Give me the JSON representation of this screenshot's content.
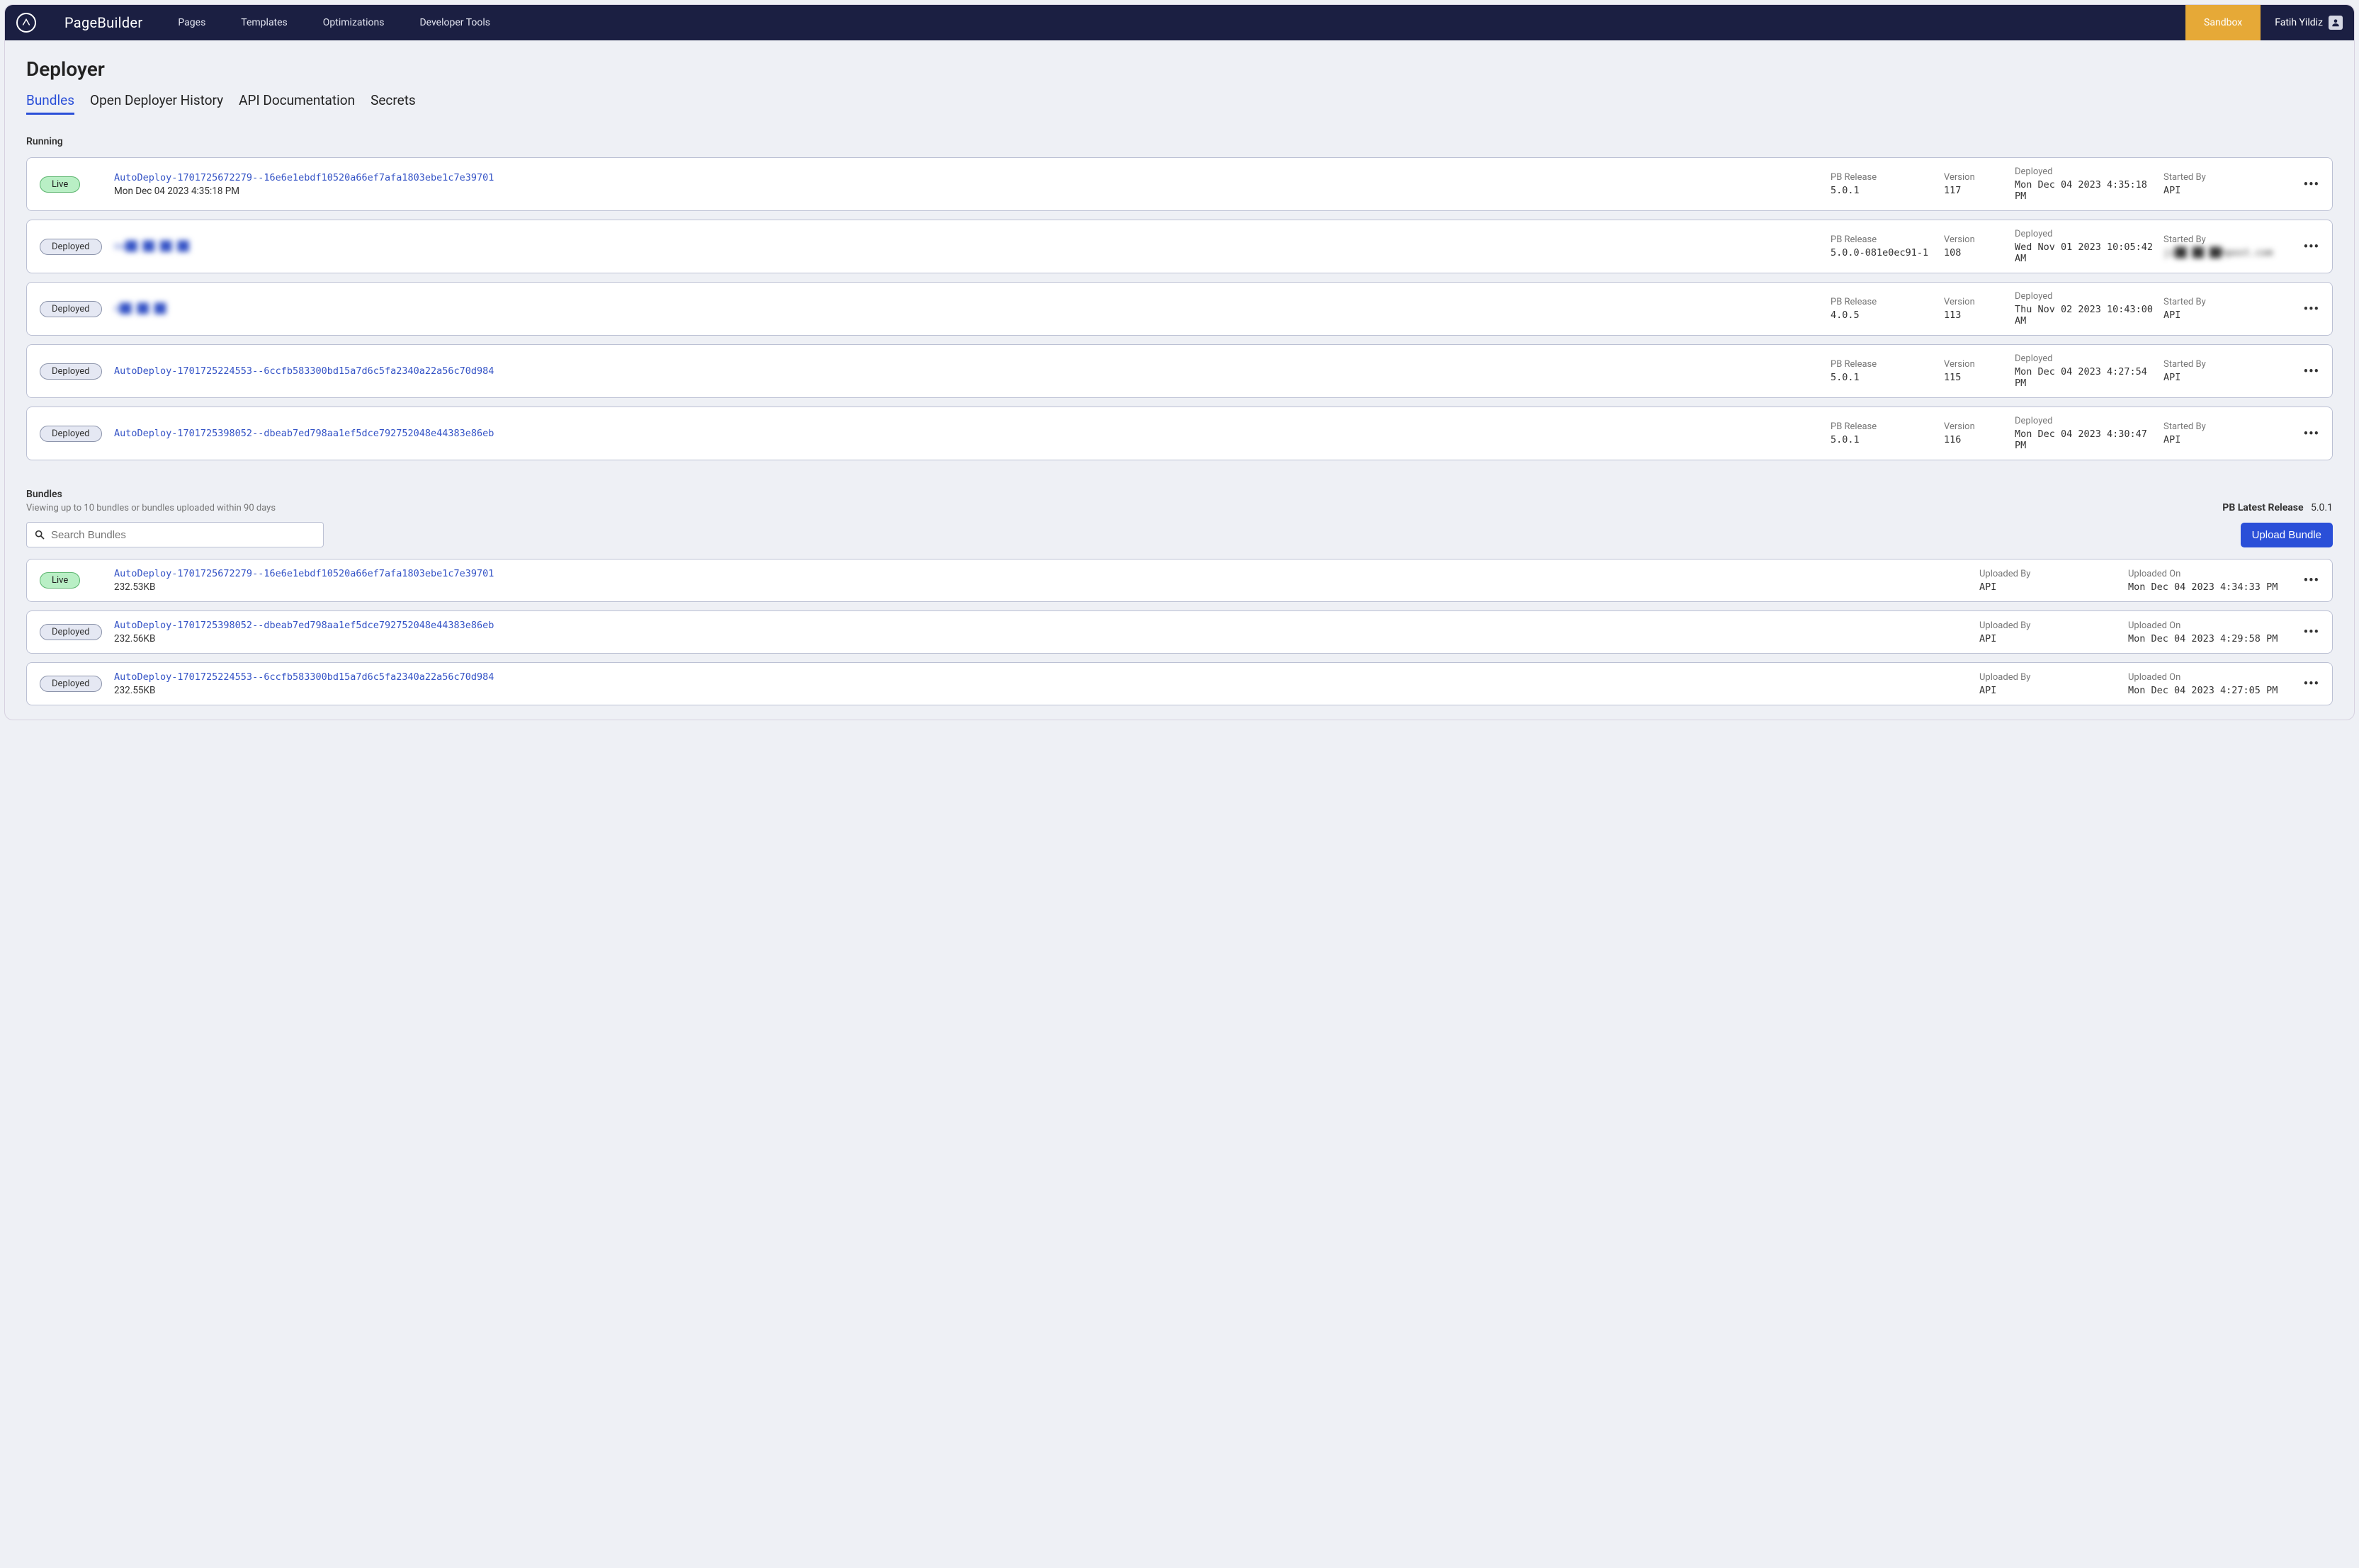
{
  "header": {
    "brand": "PageBuilder",
    "nav": [
      "Pages",
      "Templates",
      "Optimizations",
      "Developer Tools"
    ],
    "sandbox": "Sandbox",
    "user": "Fatih Yildiz"
  },
  "page": {
    "title": "Deployer",
    "tabs": [
      "Bundles",
      "Open Deployer History",
      "API Documentation",
      "Secrets"
    ],
    "active_tab": 0
  },
  "running": {
    "label": "Running",
    "labels": {
      "pb_release": "PB Release",
      "version": "Version",
      "deployed": "Deployed",
      "started_by": "Started By"
    },
    "rows": [
      {
        "status": "Live",
        "name": "AutoDeploy-1701725672279--16e6e1ebdf10520a66ef7afa1803ebe1c7e39701",
        "sub": "Mon Dec 04 2023 4:35:18 PM",
        "pb_release": "5.0.1",
        "version": "117",
        "deployed": "Mon Dec 04 2023 4:35:18 PM",
        "started_by": "API",
        "blur_name": false,
        "blur_by": false
      },
      {
        "status": "Deployed",
        "name": "no██ ██ ██  ██",
        "sub": "",
        "pb_release": "5.0.0-081e0ec91-1",
        "version": "108",
        "deployed": "Wed Nov 01 2023 10:05:42 AM",
        "started_by": "ji██ ██ ██hpost.com",
        "blur_name": true,
        "blur_by": true
      },
      {
        "status": "Deployed",
        "name": "n██ ██ ██",
        "sub": "",
        "pb_release": "4.0.5",
        "version": "113",
        "deployed": "Thu Nov 02 2023 10:43:00 AM",
        "started_by": "API",
        "blur_name": true,
        "blur_by": false
      },
      {
        "status": "Deployed",
        "name": "AutoDeploy-1701725224553--6ccfb583300bd15a7d6c5fa2340a22a56c70d984",
        "sub": "",
        "pb_release": "5.0.1",
        "version": "115",
        "deployed": "Mon Dec 04 2023 4:27:54 PM",
        "started_by": "API",
        "blur_name": false,
        "blur_by": false
      },
      {
        "status": "Deployed",
        "name": "AutoDeploy-1701725398052--dbeab7ed798aa1ef5dce792752048e44383e86eb",
        "sub": "",
        "pb_release": "5.0.1",
        "version": "116",
        "deployed": "Mon Dec 04 2023 4:30:47 PM",
        "started_by": "API",
        "blur_name": false,
        "blur_by": false
      }
    ]
  },
  "bundles": {
    "label": "Bundles",
    "hint": "Viewing up to 10 bundles or bundles uploaded within 90 days",
    "latest_label": "PB Latest Release",
    "latest_value": "5.0.1",
    "search_placeholder": "Search Bundles",
    "upload_label": "Upload Bundle",
    "labels": {
      "uploaded_by": "Uploaded By",
      "uploaded_on": "Uploaded On"
    },
    "rows": [
      {
        "status": "Live",
        "name": "AutoDeploy-1701725672279--16e6e1ebdf10520a66ef7afa1803ebe1c7e39701",
        "size": "232.53KB",
        "uploaded_by": "API",
        "uploaded_on": "Mon Dec 04 2023 4:34:33 PM"
      },
      {
        "status": "Deployed",
        "name": "AutoDeploy-1701725398052--dbeab7ed798aa1ef5dce792752048e44383e86eb",
        "size": "232.56KB",
        "uploaded_by": "API",
        "uploaded_on": "Mon Dec 04 2023 4:29:58 PM"
      },
      {
        "status": "Deployed",
        "name": "AutoDeploy-1701725224553--6ccfb583300bd15a7d6c5fa2340a22a56c70d984",
        "size": "232.55KB",
        "uploaded_by": "API",
        "uploaded_on": "Mon Dec 04 2023 4:27:05 PM"
      }
    ]
  }
}
